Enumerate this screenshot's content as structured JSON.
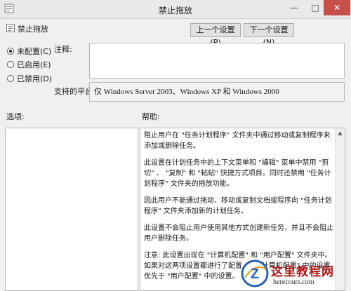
{
  "window": {
    "title": "禁止拖放",
    "minimize_glyph": "—",
    "maximize_glyph": "□",
    "close_glyph": "✕"
  },
  "policy": {
    "name": "禁止拖放"
  },
  "nav": {
    "prev_label": "上一个设置(P)",
    "next_label": "下一个设置(N)"
  },
  "state": {
    "options": [
      {
        "label": "未配置(C)",
        "checked": true
      },
      {
        "label": "已启用(E)",
        "checked": false
      },
      {
        "label": "已禁用(D)",
        "checked": false
      }
    ]
  },
  "comment": {
    "label": "注释:",
    "value": ""
  },
  "platform": {
    "label": "支持的平台:",
    "value": "仅 Windows Server 2003、Windows XP 和 Windows 2000"
  },
  "options_pane": {
    "label": "选项:"
  },
  "help": {
    "label": "帮助:",
    "paragraphs": [
      "阻止用户在 \"任务计划程序\" 文件夹中通过移动或复制程序来添加或删除任务。",
      "此设置在计划任务中的上下文菜单和 \"编辑\" 菜单中禁用 \"剪切\" 、 \"复制\" 和 \"粘贴\" 快捷方式项目。同时还禁用 \"任务计划程序\" 文件夹的拖放功能。",
      "因此用户不能通过拖动、移动或复制文档或程序向 \"任务计划程序\" 文件夹添加新的计划任务。",
      "此设置不会阻止用户使用其他方式创建新任务，并且不会阻止用户删除任务。",
      "注意: 此设置出现在 \"计算机配置\" 和 \"用户配置\" 文件夹中。如果对这两项设置都进行了配置，则 \"计算机配置\" 中的设置优先于 \"用户配置\" 中的设置。"
    ]
  },
  "watermark": {
    "title": "这里教程网",
    "url": "herecours.com",
    "logo_letter": "Z"
  },
  "colors": {
    "close_button": "#c7504b",
    "watermark_red": "#b01818"
  }
}
